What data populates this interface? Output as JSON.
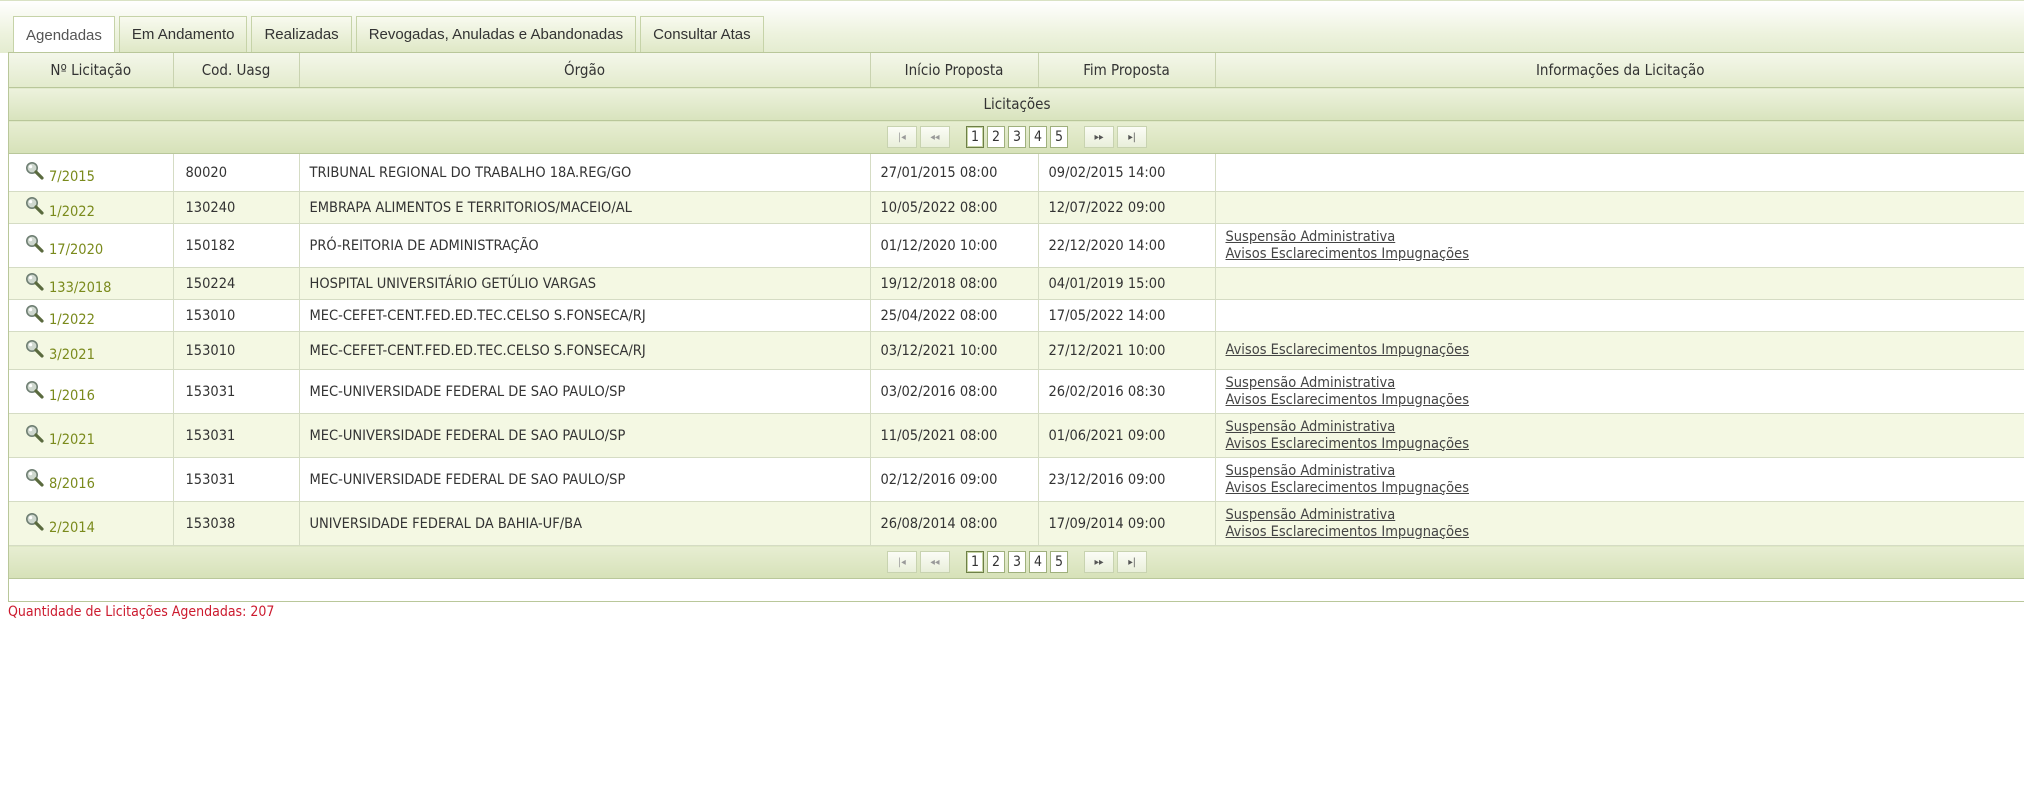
{
  "tabs": [
    {
      "label": "Agendadas",
      "active": true
    },
    {
      "label": "Em Andamento",
      "active": false
    },
    {
      "label": "Realizadas",
      "active": false
    },
    {
      "label": "Revogadas, Anuladas e Abandonadas",
      "active": false
    },
    {
      "label": "Consultar Atas",
      "active": false
    }
  ],
  "table": {
    "caption": "Licitações",
    "columns": [
      "Nº Licitação",
      "Cod. Uasg",
      "Órgão",
      "Início Proposta",
      "Fim Proposta",
      "Informações da Licitação"
    ],
    "rows": [
      {
        "numero": "7/2015",
        "uasg": "80020",
        "orgao": "TRIBUNAL REGIONAL DO TRABALHO 18A.REG/GO",
        "inicio": "27/01/2015 08:00",
        "fim": "09/02/2015 14:00",
        "info": []
      },
      {
        "numero": "1/2022",
        "uasg": "130240",
        "orgao": "EMBRAPA ALIMENTOS E TERRITORIOS/MACEIO/AL",
        "inicio": "10/05/2022 08:00",
        "fim": "12/07/2022 09:00",
        "info": []
      },
      {
        "numero": "17/2020",
        "uasg": "150182",
        "orgao": "PRÓ-REITORIA DE ADMINISTRAÇÃO",
        "inicio": "01/12/2020 10:00",
        "fim": "22/12/2020 14:00",
        "info": [
          "Suspensão Administrativa",
          "Avisos Esclarecimentos Impugnações"
        ]
      },
      {
        "numero": "133/2018",
        "uasg": "150224",
        "orgao": "HOSPITAL UNIVERSITÁRIO GETÚLIO VARGAS",
        "inicio": "19/12/2018 08:00",
        "fim": "04/01/2019 15:00",
        "info": []
      },
      {
        "numero": "1/2022",
        "uasg": "153010",
        "orgao": "MEC-CEFET-CENT.FED.ED.TEC.CELSO S.FONSECA/RJ",
        "inicio": "25/04/2022 08:00",
        "fim": "17/05/2022 14:00",
        "info": []
      },
      {
        "numero": "3/2021",
        "uasg": "153010",
        "orgao": "MEC-CEFET-CENT.FED.ED.TEC.CELSO S.FONSECA/RJ",
        "inicio": "03/12/2021 10:00",
        "fim": "27/12/2021 10:00",
        "info": [
          "Avisos Esclarecimentos Impugnações"
        ]
      },
      {
        "numero": "1/2016",
        "uasg": "153031",
        "orgao": "MEC-UNIVERSIDADE FEDERAL DE SAO PAULO/SP",
        "inicio": "03/02/2016 08:00",
        "fim": "26/02/2016 08:30",
        "info": [
          "Suspensão Administrativa",
          "Avisos Esclarecimentos Impugnações"
        ]
      },
      {
        "numero": "1/2021",
        "uasg": "153031",
        "orgao": "MEC-UNIVERSIDADE FEDERAL DE SAO PAULO/SP",
        "inicio": "11/05/2021 08:00",
        "fim": "01/06/2021 09:00",
        "info": [
          "Suspensão Administrativa",
          "Avisos Esclarecimentos Impugnações"
        ]
      },
      {
        "numero": "8/2016",
        "uasg": "153031",
        "orgao": "MEC-UNIVERSIDADE FEDERAL DE SAO PAULO/SP",
        "inicio": "02/12/2016 09:00",
        "fim": "23/12/2016 09:00",
        "info": [
          "Suspensão Administrativa",
          "Avisos Esclarecimentos Impugnações"
        ]
      },
      {
        "numero": "2/2014",
        "uasg": "153038",
        "orgao": "UNIVERSIDADE FEDERAL DA BAHIA-UF/BA",
        "inicio": "26/08/2014 08:00",
        "fim": "17/09/2014 09:00",
        "info": [
          "Suspensão Administrativa",
          "Avisos Esclarecimentos Impugnações"
        ]
      }
    ]
  },
  "pager": {
    "pages": [
      "1",
      "2",
      "3",
      "4",
      "5"
    ],
    "current": "1",
    "first_label": "|◂",
    "prev_label": "◂◂",
    "next_label": "▸▸",
    "last_label": "▸|"
  },
  "footer": {
    "count_text": "Quantidade de Licitações Agendadas: 207"
  },
  "colors": {
    "link_green": "#7a8a1c",
    "footer_red": "#cc1a2e",
    "row_alt": "#f4f8e3"
  },
  "icons": {
    "row_link": "magnifier-icon"
  }
}
